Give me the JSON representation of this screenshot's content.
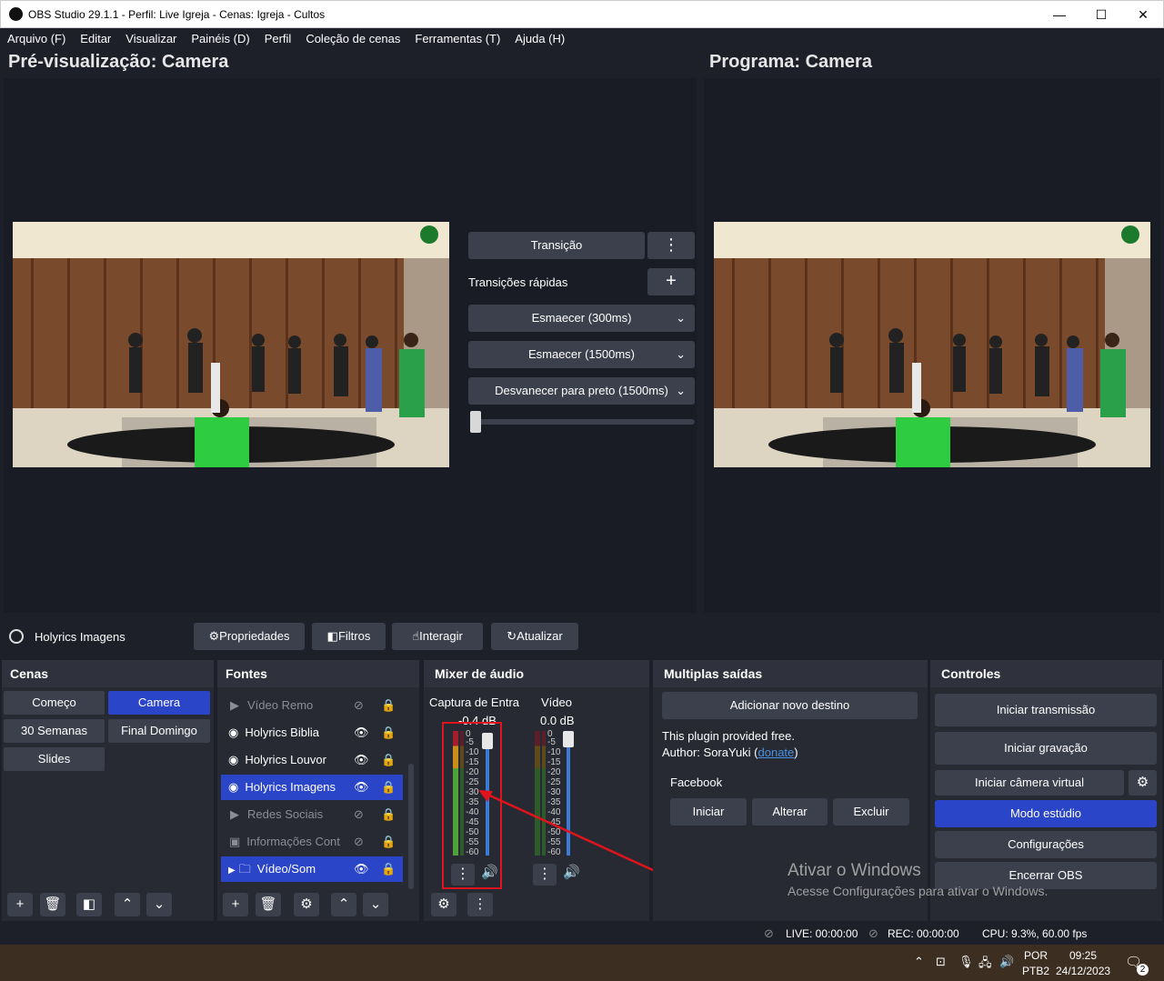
{
  "window": {
    "title": "OBS Studio 29.1.1 - Perfil: Live Igreja - Cenas: Igreja - Cultos",
    "minimize": "—",
    "maximize": "☐",
    "close": "✕"
  },
  "menu": [
    "Arquivo (F)",
    "Editar",
    "Visualizar",
    "Painéis (D)",
    "Perfil",
    "Coleção de cenas",
    "Ferramentas (T)",
    "Ajuda (H)"
  ],
  "preview": {
    "label": "Pré-visualização: Camera"
  },
  "program": {
    "label": "Programa: Camera"
  },
  "transition": {
    "button": "Transição",
    "quick_label": "Transições rápidas",
    "quick": [
      "Esmaecer (300ms)",
      "Esmaecer (1500ms)",
      "Desvanecer para preto (1500ms)"
    ],
    "slider_fraction": 0.0
  },
  "source_toolbar": {
    "selected": "Holyrics Imagens",
    "properties": "Propriedades",
    "filters": "Filtros",
    "interact": "Interagir",
    "refresh": "Atualizar"
  },
  "scenes": {
    "title": "Cenas",
    "items": [
      "Começo",
      "Camera",
      "30 Semanas",
      "Final Domingo",
      "Slides"
    ],
    "active": "Camera"
  },
  "sources": {
    "title": "Fontes",
    "items": [
      {
        "name": "Vídeo Remo",
        "type": "media",
        "visible": false,
        "active": false
      },
      {
        "name": "Holyrics Biblia",
        "type": "browser",
        "visible": true,
        "active": false
      },
      {
        "name": "Holyrics Louvor",
        "type": "browser",
        "visible": true,
        "active": false
      },
      {
        "name": "Holyrics Imagens",
        "type": "browser",
        "visible": true,
        "active": true
      },
      {
        "name": "Redes Sociais",
        "type": "media",
        "visible": false,
        "active": false
      },
      {
        "name": "Informações Cont",
        "type": "image",
        "visible": false,
        "active": false
      },
      {
        "name": "Vídeo/Som",
        "type": "group",
        "visible": true,
        "active": true
      }
    ]
  },
  "mixer": {
    "title": "Mixer de áudio",
    "channels": [
      {
        "name": "Captura de Entra",
        "db": "-0.4 dB",
        "fader": 0.98
      },
      {
        "name": "Vídeo",
        "db": "0.0 dB",
        "fader": 1.0
      }
    ],
    "scale": [
      "0",
      "-5",
      "-10",
      "-15",
      "-20",
      "-25",
      "-30",
      "-35",
      "-40",
      "-45",
      "-50",
      "-55",
      "-60"
    ]
  },
  "outputs": {
    "title": "Multiplas saídas",
    "add": "Adicionar novo destino",
    "note1": "This plugin provided free.",
    "note2_prefix": "Author: SoraYuki (",
    "donate": "donate",
    "note2_suffix": ")",
    "target": "Facebook",
    "start": "Iniciar",
    "edit": "Alterar",
    "delete": "Excluir"
  },
  "controls": {
    "title": "Controles",
    "stream": "Iniciar transmissão",
    "record": "Iniciar gravação",
    "virtualcam": "Iniciar câmera virtual",
    "studio": "Modo estúdio",
    "settings": "Configurações",
    "exit": "Encerrar OBS"
  },
  "watermark": {
    "line1": "Ativar o Windows",
    "line2": "Acesse Configurações para ativar o Windows."
  },
  "status": {
    "live": "LIVE: 00:00:00",
    "rec": "REC: 00:00:00",
    "cpu": "CPU: 9.3%, 60.00 fps"
  },
  "taskbar": {
    "lang1": "POR",
    "lang2": "PTB2",
    "time": "09:25",
    "date": "24/12/2023",
    "notif": "2"
  },
  "colors": {
    "accent": "#2b45c8",
    "bg": "#1e2029",
    "dock": "#272a33",
    "button": "#3c404d",
    "annotation": "#e0141c"
  }
}
